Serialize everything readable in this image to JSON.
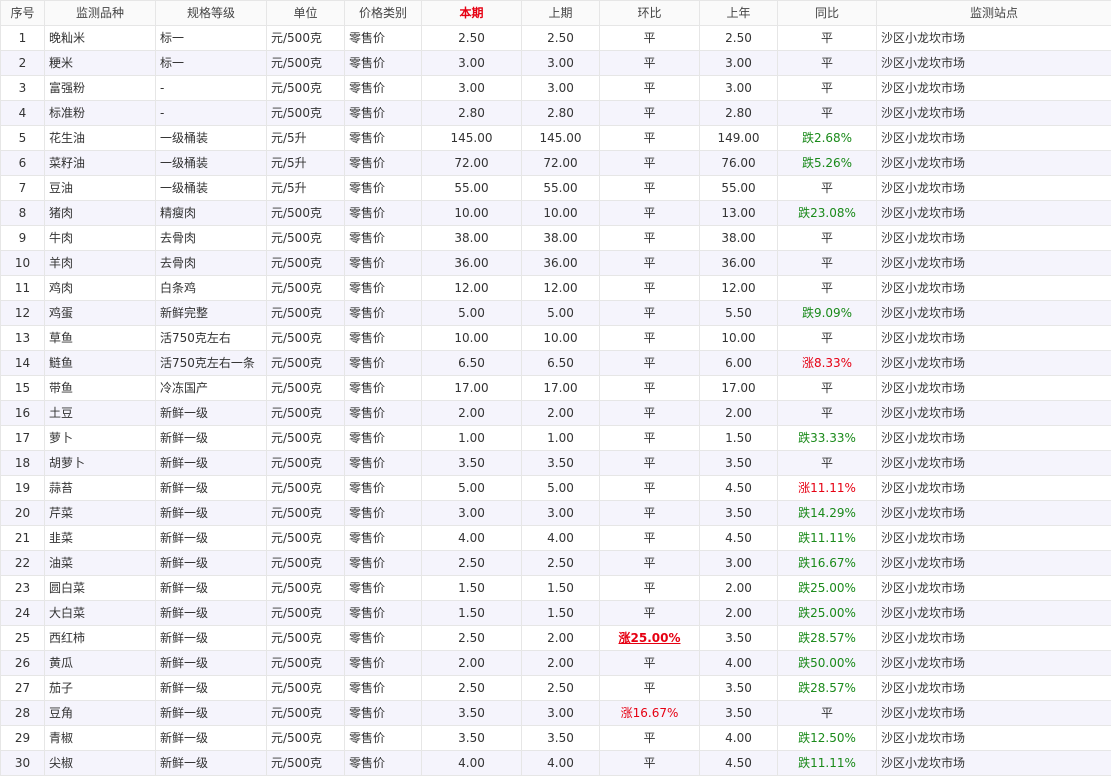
{
  "headers": [
    "序号",
    "监测品种",
    "规格等级",
    "单位",
    "价格类别",
    "本期",
    "上期",
    "环比",
    "上年",
    "同比",
    "监测站点"
  ],
  "highlight_header": "本期",
  "colors": {
    "current_header": "#e60012",
    "rise": "#e60012",
    "fall": "#1a8a1a",
    "row_alt": "#f5f4fc",
    "border": "#e6e6e6"
  },
  "rows": [
    {
      "no": "1",
      "item": "晚籼米",
      "grade": "标一",
      "unit": "元/500克",
      "ptype": "零售价",
      "cur": "2.50",
      "prev": "2.50",
      "mom": "平",
      "mom_dir": "flat",
      "lastyear": "2.50",
      "yoy": "平",
      "yoy_dir": "flat",
      "station": "沙区小龙坎市场"
    },
    {
      "no": "2",
      "item": "粳米",
      "grade": "标一",
      "unit": "元/500克",
      "ptype": "零售价",
      "cur": "3.00",
      "prev": "3.00",
      "mom": "平",
      "mom_dir": "flat",
      "lastyear": "3.00",
      "yoy": "平",
      "yoy_dir": "flat",
      "station": "沙区小龙坎市场"
    },
    {
      "no": "3",
      "item": "富强粉",
      "grade": "-",
      "unit": "元/500克",
      "ptype": "零售价",
      "cur": "3.00",
      "prev": "3.00",
      "mom": "平",
      "mom_dir": "flat",
      "lastyear": "3.00",
      "yoy": "平",
      "yoy_dir": "flat",
      "station": "沙区小龙坎市场"
    },
    {
      "no": "4",
      "item": "标准粉",
      "grade": "-",
      "unit": "元/500克",
      "ptype": "零售价",
      "cur": "2.80",
      "prev": "2.80",
      "mom": "平",
      "mom_dir": "flat",
      "lastyear": "2.80",
      "yoy": "平",
      "yoy_dir": "flat",
      "station": "沙区小龙坎市场"
    },
    {
      "no": "5",
      "item": "花生油",
      "grade": "一级桶装",
      "unit": "元/5升",
      "ptype": "零售价",
      "cur": "145.00",
      "prev": "145.00",
      "mom": "平",
      "mom_dir": "flat",
      "lastyear": "149.00",
      "yoy": "跌2.68%",
      "yoy_dir": "down",
      "station": "沙区小龙坎市场"
    },
    {
      "no": "6",
      "item": "菜籽油",
      "grade": "一级桶装",
      "unit": "元/5升",
      "ptype": "零售价",
      "cur": "72.00",
      "prev": "72.00",
      "mom": "平",
      "mom_dir": "flat",
      "lastyear": "76.00",
      "yoy": "跌5.26%",
      "yoy_dir": "down",
      "station": "沙区小龙坎市场"
    },
    {
      "no": "7",
      "item": "豆油",
      "grade": "一级桶装",
      "unit": "元/5升",
      "ptype": "零售价",
      "cur": "55.00",
      "prev": "55.00",
      "mom": "平",
      "mom_dir": "flat",
      "lastyear": "55.00",
      "yoy": "平",
      "yoy_dir": "flat",
      "station": "沙区小龙坎市场"
    },
    {
      "no": "8",
      "item": "猪肉",
      "grade": "精瘦肉",
      "unit": "元/500克",
      "ptype": "零售价",
      "cur": "10.00",
      "prev": "10.00",
      "mom": "平",
      "mom_dir": "flat",
      "lastyear": "13.00",
      "yoy": "跌23.08%",
      "yoy_dir": "down",
      "station": "沙区小龙坎市场"
    },
    {
      "no": "9",
      "item": "牛肉",
      "grade": "去骨肉",
      "unit": "元/500克",
      "ptype": "零售价",
      "cur": "38.00",
      "prev": "38.00",
      "mom": "平",
      "mom_dir": "flat",
      "lastyear": "38.00",
      "yoy": "平",
      "yoy_dir": "flat",
      "station": "沙区小龙坎市场"
    },
    {
      "no": "10",
      "item": "羊肉",
      "grade": "去骨肉",
      "unit": "元/500克",
      "ptype": "零售价",
      "cur": "36.00",
      "prev": "36.00",
      "mom": "平",
      "mom_dir": "flat",
      "lastyear": "36.00",
      "yoy": "平",
      "yoy_dir": "flat",
      "station": "沙区小龙坎市场"
    },
    {
      "no": "11",
      "item": "鸡肉",
      "grade": "白条鸡",
      "unit": "元/500克",
      "ptype": "零售价",
      "cur": "12.00",
      "prev": "12.00",
      "mom": "平",
      "mom_dir": "flat",
      "lastyear": "12.00",
      "yoy": "平",
      "yoy_dir": "flat",
      "station": "沙区小龙坎市场"
    },
    {
      "no": "12",
      "item": "鸡蛋",
      "grade": "新鲜完整",
      "unit": "元/500克",
      "ptype": "零售价",
      "cur": "5.00",
      "prev": "5.00",
      "mom": "平",
      "mom_dir": "flat",
      "lastyear": "5.50",
      "yoy": "跌9.09%",
      "yoy_dir": "down",
      "station": "沙区小龙坎市场"
    },
    {
      "no": "13",
      "item": "草鱼",
      "grade": "活750克左右",
      "unit": "元/500克",
      "ptype": "零售价",
      "cur": "10.00",
      "prev": "10.00",
      "mom": "平",
      "mom_dir": "flat",
      "lastyear": "10.00",
      "yoy": "平",
      "yoy_dir": "flat",
      "station": "沙区小龙坎市场"
    },
    {
      "no": "14",
      "item": "鲢鱼",
      "grade": "活750克左右一条",
      "unit": "元/500克",
      "ptype": "零售价",
      "cur": "6.50",
      "prev": "6.50",
      "mom": "平",
      "mom_dir": "flat",
      "lastyear": "6.00",
      "yoy": "涨8.33%",
      "yoy_dir": "up",
      "station": "沙区小龙坎市场"
    },
    {
      "no": "15",
      "item": "带鱼",
      "grade": "冷冻国产",
      "unit": "元/500克",
      "ptype": "零售价",
      "cur": "17.00",
      "prev": "17.00",
      "mom": "平",
      "mom_dir": "flat",
      "lastyear": "17.00",
      "yoy": "平",
      "yoy_dir": "flat",
      "station": "沙区小龙坎市场"
    },
    {
      "no": "16",
      "item": "土豆",
      "grade": "新鲜一级",
      "unit": "元/500克",
      "ptype": "零售价",
      "cur": "2.00",
      "prev": "2.00",
      "mom": "平",
      "mom_dir": "flat",
      "lastyear": "2.00",
      "yoy": "平",
      "yoy_dir": "flat",
      "station": "沙区小龙坎市场"
    },
    {
      "no": "17",
      "item": "萝卜",
      "grade": "新鲜一级",
      "unit": "元/500克",
      "ptype": "零售价",
      "cur": "1.00",
      "prev": "1.00",
      "mom": "平",
      "mom_dir": "flat",
      "lastyear": "1.50",
      "yoy": "跌33.33%",
      "yoy_dir": "down",
      "station": "沙区小龙坎市场"
    },
    {
      "no": "18",
      "item": "胡萝卜",
      "grade": "新鲜一级",
      "unit": "元/500克",
      "ptype": "零售价",
      "cur": "3.50",
      "prev": "3.50",
      "mom": "平",
      "mom_dir": "flat",
      "lastyear": "3.50",
      "yoy": "平",
      "yoy_dir": "flat",
      "station": "沙区小龙坎市场"
    },
    {
      "no": "19",
      "item": "蒜苔",
      "grade": "新鲜一级",
      "unit": "元/500克",
      "ptype": "零售价",
      "cur": "5.00",
      "prev": "5.00",
      "mom": "平",
      "mom_dir": "flat",
      "lastyear": "4.50",
      "yoy": "涨11.11%",
      "yoy_dir": "up",
      "station": "沙区小龙坎市场"
    },
    {
      "no": "20",
      "item": "芹菜",
      "grade": "新鲜一级",
      "unit": "元/500克",
      "ptype": "零售价",
      "cur": "3.00",
      "prev": "3.00",
      "mom": "平",
      "mom_dir": "flat",
      "lastyear": "3.50",
      "yoy": "跌14.29%",
      "yoy_dir": "down",
      "station": "沙区小龙坎市场"
    },
    {
      "no": "21",
      "item": "韭菜",
      "grade": "新鲜一级",
      "unit": "元/500克",
      "ptype": "零售价",
      "cur": "4.00",
      "prev": "4.00",
      "mom": "平",
      "mom_dir": "flat",
      "lastyear": "4.50",
      "yoy": "跌11.11%",
      "yoy_dir": "down",
      "station": "沙区小龙坎市场"
    },
    {
      "no": "22",
      "item": "油菜",
      "grade": "新鲜一级",
      "unit": "元/500克",
      "ptype": "零售价",
      "cur": "2.50",
      "prev": "2.50",
      "mom": "平",
      "mom_dir": "flat",
      "lastyear": "3.00",
      "yoy": "跌16.67%",
      "yoy_dir": "down",
      "station": "沙区小龙坎市场"
    },
    {
      "no": "23",
      "item": "圆白菜",
      "grade": "新鲜一级",
      "unit": "元/500克",
      "ptype": "零售价",
      "cur": "1.50",
      "prev": "1.50",
      "mom": "平",
      "mom_dir": "flat",
      "lastyear": "2.00",
      "yoy": "跌25.00%",
      "yoy_dir": "down",
      "station": "沙区小龙坎市场"
    },
    {
      "no": "24",
      "item": "大白菜",
      "grade": "新鲜一级",
      "unit": "元/500克",
      "ptype": "零售价",
      "cur": "1.50",
      "prev": "1.50",
      "mom": "平",
      "mom_dir": "flat",
      "lastyear": "2.00",
      "yoy": "跌25.00%",
      "yoy_dir": "down",
      "station": "沙区小龙坎市场"
    },
    {
      "no": "25",
      "item": "西红柿",
      "grade": "新鲜一级",
      "unit": "元/500克",
      "ptype": "零售价",
      "cur": "2.50",
      "prev": "2.00",
      "mom": "涨25.00%",
      "mom_dir": "up-strong",
      "lastyear": "3.50",
      "yoy": "跌28.57%",
      "yoy_dir": "down",
      "station": "沙区小龙坎市场"
    },
    {
      "no": "26",
      "item": "黄瓜",
      "grade": "新鲜一级",
      "unit": "元/500克",
      "ptype": "零售价",
      "cur": "2.00",
      "prev": "2.00",
      "mom": "平",
      "mom_dir": "flat",
      "lastyear": "4.00",
      "yoy": "跌50.00%",
      "yoy_dir": "down",
      "station": "沙区小龙坎市场"
    },
    {
      "no": "27",
      "item": "茄子",
      "grade": "新鲜一级",
      "unit": "元/500克",
      "ptype": "零售价",
      "cur": "2.50",
      "prev": "2.50",
      "mom": "平",
      "mom_dir": "flat",
      "lastyear": "3.50",
      "yoy": "跌28.57%",
      "yoy_dir": "down",
      "station": "沙区小龙坎市场"
    },
    {
      "no": "28",
      "item": "豆角",
      "grade": "新鲜一级",
      "unit": "元/500克",
      "ptype": "零售价",
      "cur": "3.50",
      "prev": "3.00",
      "mom": "涨16.67%",
      "mom_dir": "up",
      "lastyear": "3.50",
      "yoy": "平",
      "yoy_dir": "flat",
      "station": "沙区小龙坎市场"
    },
    {
      "no": "29",
      "item": "青椒",
      "grade": "新鲜一级",
      "unit": "元/500克",
      "ptype": "零售价",
      "cur": "3.50",
      "prev": "3.50",
      "mom": "平",
      "mom_dir": "flat",
      "lastyear": "4.00",
      "yoy": "跌12.50%",
      "yoy_dir": "down",
      "station": "沙区小龙坎市场"
    },
    {
      "no": "30",
      "item": "尖椒",
      "grade": "新鲜一级",
      "unit": "元/500克",
      "ptype": "零售价",
      "cur": "4.00",
      "prev": "4.00",
      "mom": "平",
      "mom_dir": "flat",
      "lastyear": "4.50",
      "yoy": "跌11.11%",
      "yoy_dir": "down",
      "station": "沙区小龙坎市场"
    }
  ]
}
